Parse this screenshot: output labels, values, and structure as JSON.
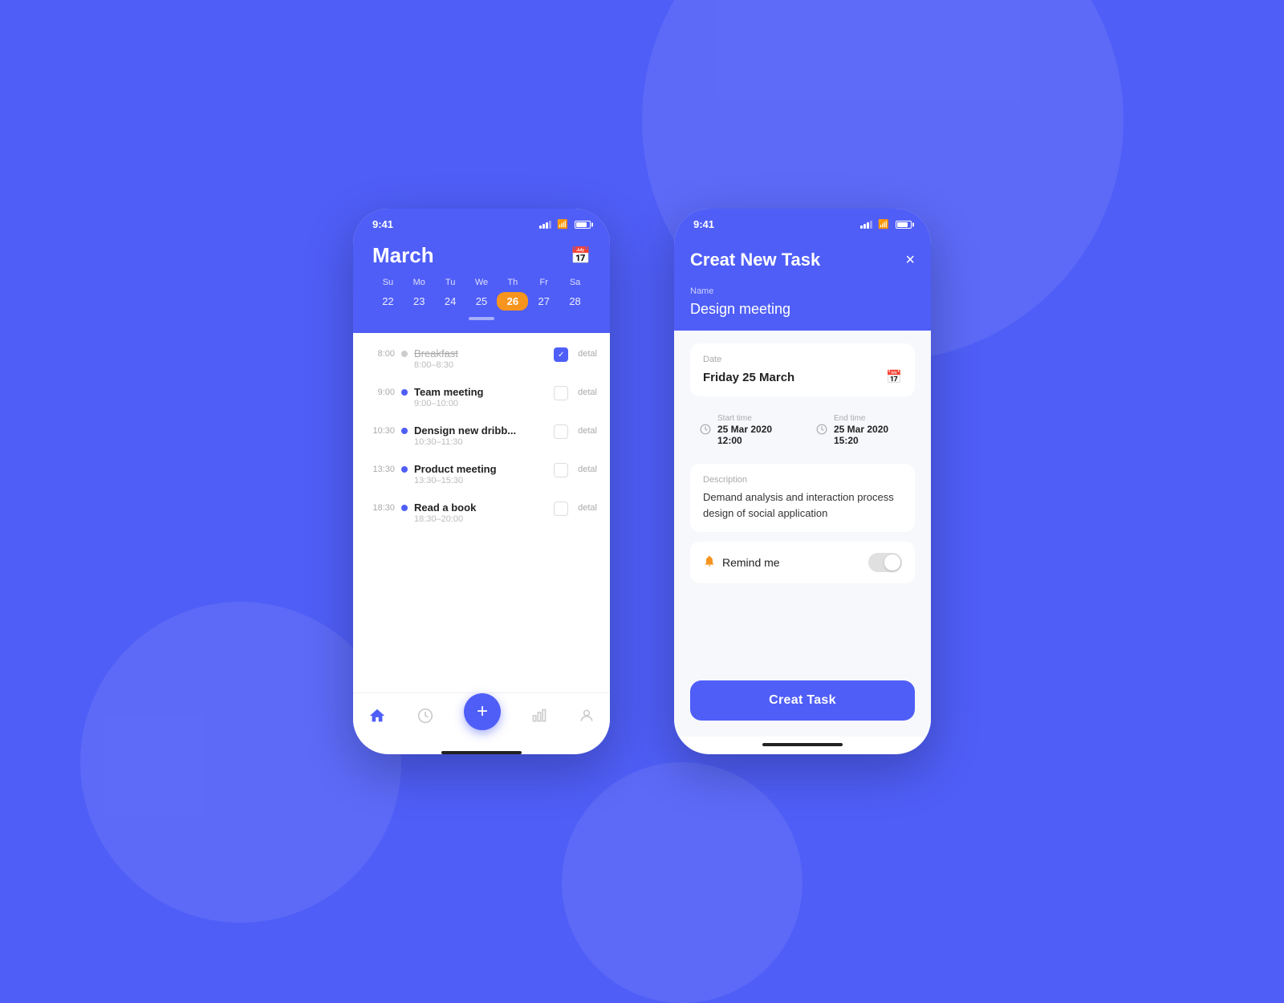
{
  "background_color": "#4f5ef7",
  "phone1": {
    "status_bar": {
      "time": "9:41"
    },
    "calendar": {
      "month": "March",
      "days_of_week": [
        "Su",
        "Mo",
        "Tu",
        "We",
        "Th",
        "Fr",
        "Sa"
      ],
      "dates": [
        "22",
        "23",
        "24",
        "25",
        "26",
        "27",
        "28"
      ],
      "active_date": "26"
    },
    "tasks": [
      {
        "time": "8:00",
        "name": "Breakfast",
        "range": "8:00–8:30",
        "completed": true,
        "dot_color": "grey"
      },
      {
        "time": "9:00",
        "name": "Team meeting",
        "range": "9:00–10:00",
        "completed": false,
        "dot_color": "blue"
      },
      {
        "time": "10:30",
        "name": "Densign new dribb...",
        "range": "10:30–11:30",
        "completed": false,
        "dot_color": "blue"
      },
      {
        "time": "13:30",
        "name": "Product meeting",
        "range": "13:30–15:30",
        "completed": false,
        "dot_color": "blue"
      },
      {
        "time": "18:30",
        "name": "Read a book",
        "range": "18:30–20:00",
        "completed": false,
        "dot_color": "blue"
      }
    ],
    "detail_label": "detal"
  },
  "phone2": {
    "status_bar": {
      "time": "9:41"
    },
    "header": {
      "title": "Creat New Task",
      "close_label": "×"
    },
    "name_field": {
      "label": "Name",
      "value": "Design meeting"
    },
    "date_field": {
      "label": "Date",
      "value": "Friday 25 March"
    },
    "start_time": {
      "label": "Start time",
      "value": "25 Mar 2020  12:00"
    },
    "end_time": {
      "label": "End time",
      "value": "25 Mar 2020  15:20"
    },
    "description": {
      "label": "Description",
      "value": "Demand analysis and interaction process design of social application"
    },
    "remind": {
      "label": "Remind me",
      "enabled": false
    },
    "create_button": {
      "label": "Creat Task"
    }
  }
}
